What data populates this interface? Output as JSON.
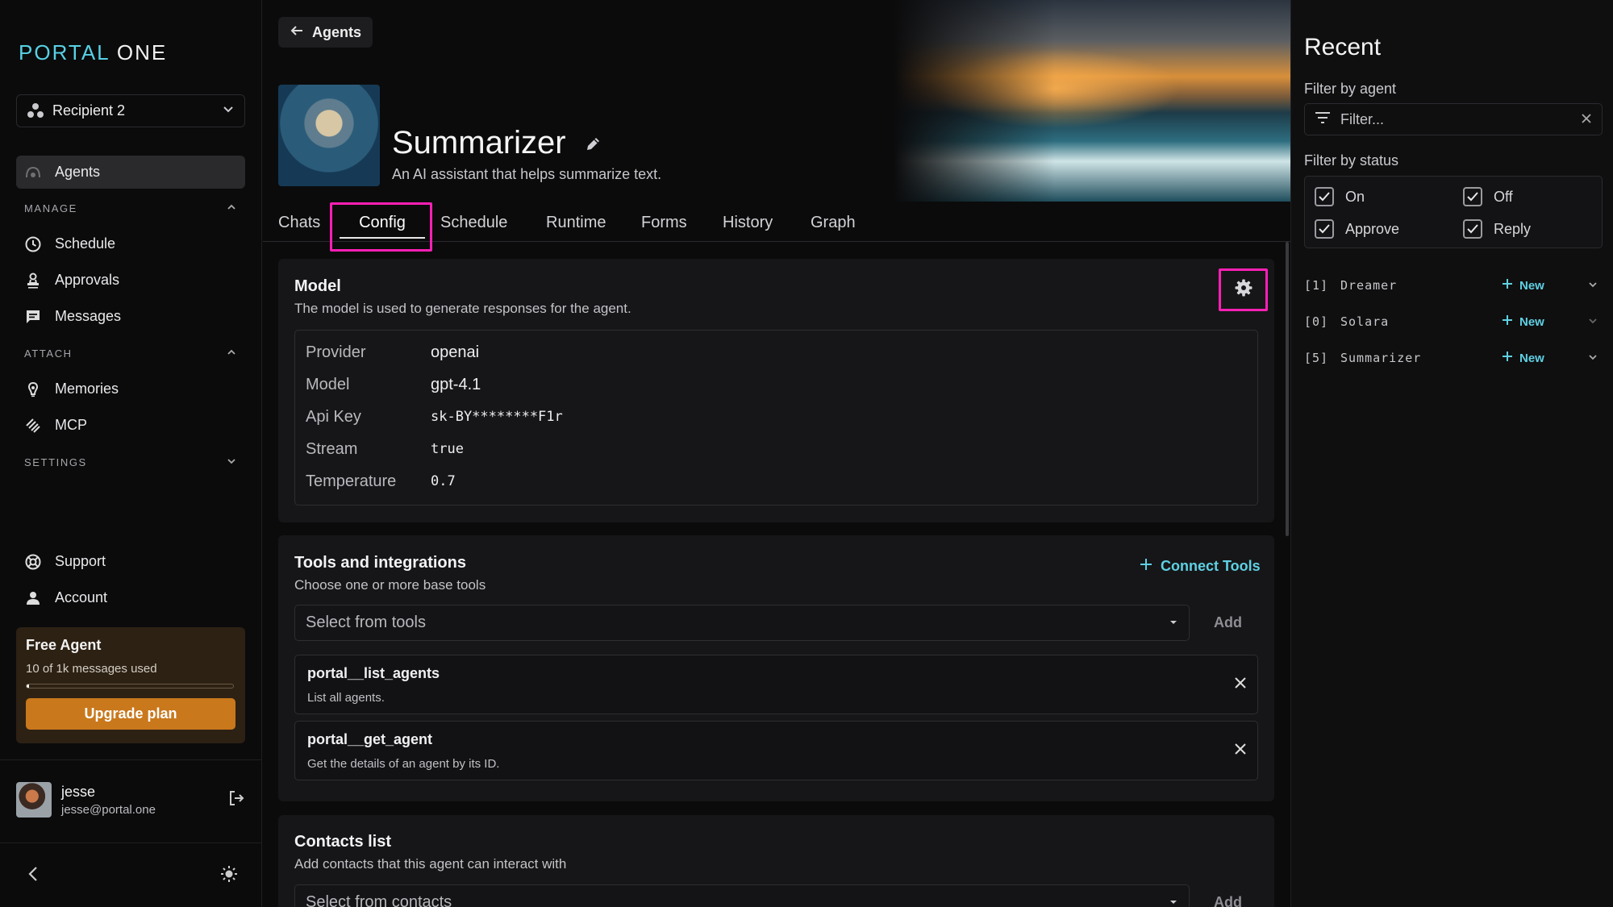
{
  "brand": {
    "part1": "PORTAL",
    "part2": "ONE"
  },
  "org_selector": {
    "value": "Recipient 2"
  },
  "nav": {
    "agents": "Agents",
    "manage_label": "MANAGE",
    "schedule": "Schedule",
    "approvals": "Approvals",
    "messages": "Messages",
    "attach_label": "ATTACH",
    "memories": "Memories",
    "mcp": "MCP",
    "settings_label": "SETTINGS",
    "support": "Support",
    "account": "Account"
  },
  "plan": {
    "title": "Free Agent",
    "usage": "10 of 1k messages used",
    "usage_fraction": 0.01,
    "upgrade_label": "Upgrade plan"
  },
  "user": {
    "name": "jesse",
    "email": "jesse@portal.one"
  },
  "header": {
    "back_label": "Agents",
    "agent_name": "Summarizer",
    "agent_description": "An AI assistant that helps summarize text."
  },
  "tabs": [
    "Chats",
    "Config",
    "Schedule",
    "Runtime",
    "Forms",
    "History",
    "Graph"
  ],
  "active_tab": "Config",
  "model_card": {
    "title": "Model",
    "subtitle": "The model is used to generate responses for the agent.",
    "rows": [
      {
        "key": "Provider",
        "value": "openai"
      },
      {
        "key": "Model",
        "value": "gpt-4.1"
      },
      {
        "key": "Api Key",
        "value": "sk-BY********F1r"
      },
      {
        "key": "Stream",
        "value": "true"
      },
      {
        "key": "Temperature",
        "value": "0.7"
      }
    ]
  },
  "tools_card": {
    "title": "Tools and integrations",
    "subtitle": "Choose one or more base tools",
    "connect_label": "Connect Tools",
    "select_placeholder": "Select from tools",
    "add_label": "Add",
    "tools": [
      {
        "name": "portal__list_agents",
        "description": "List all agents."
      },
      {
        "name": "portal__get_agent",
        "description": "Get the details of an agent by its ID."
      }
    ]
  },
  "contacts_card": {
    "title": "Contacts list",
    "subtitle": "Add contacts that this agent can interact with",
    "select_placeholder": "Select from contacts",
    "add_label": "Add"
  },
  "recent": {
    "title": "Recent",
    "filter_agent_label": "Filter by agent",
    "filter_placeholder": "Filter...",
    "filter_status_label": "Filter by status",
    "statuses": [
      {
        "label": "On",
        "checked": true
      },
      {
        "label": "Off",
        "checked": true
      },
      {
        "label": "Approve",
        "checked": true
      },
      {
        "label": "Reply",
        "checked": true
      }
    ],
    "items": [
      {
        "index": "[1]",
        "name": "Dreamer",
        "new_label": "New"
      },
      {
        "index": "[0]",
        "name": "Solara",
        "new_label": "New"
      },
      {
        "index": "[5]",
        "name": "Summarizer",
        "new_label": "New"
      }
    ]
  },
  "colors": {
    "accent": "#5fd0e3",
    "highlight": "#ff1fb5",
    "upgrade": "#c9781c",
    "plan_bg": "#2d2114"
  }
}
